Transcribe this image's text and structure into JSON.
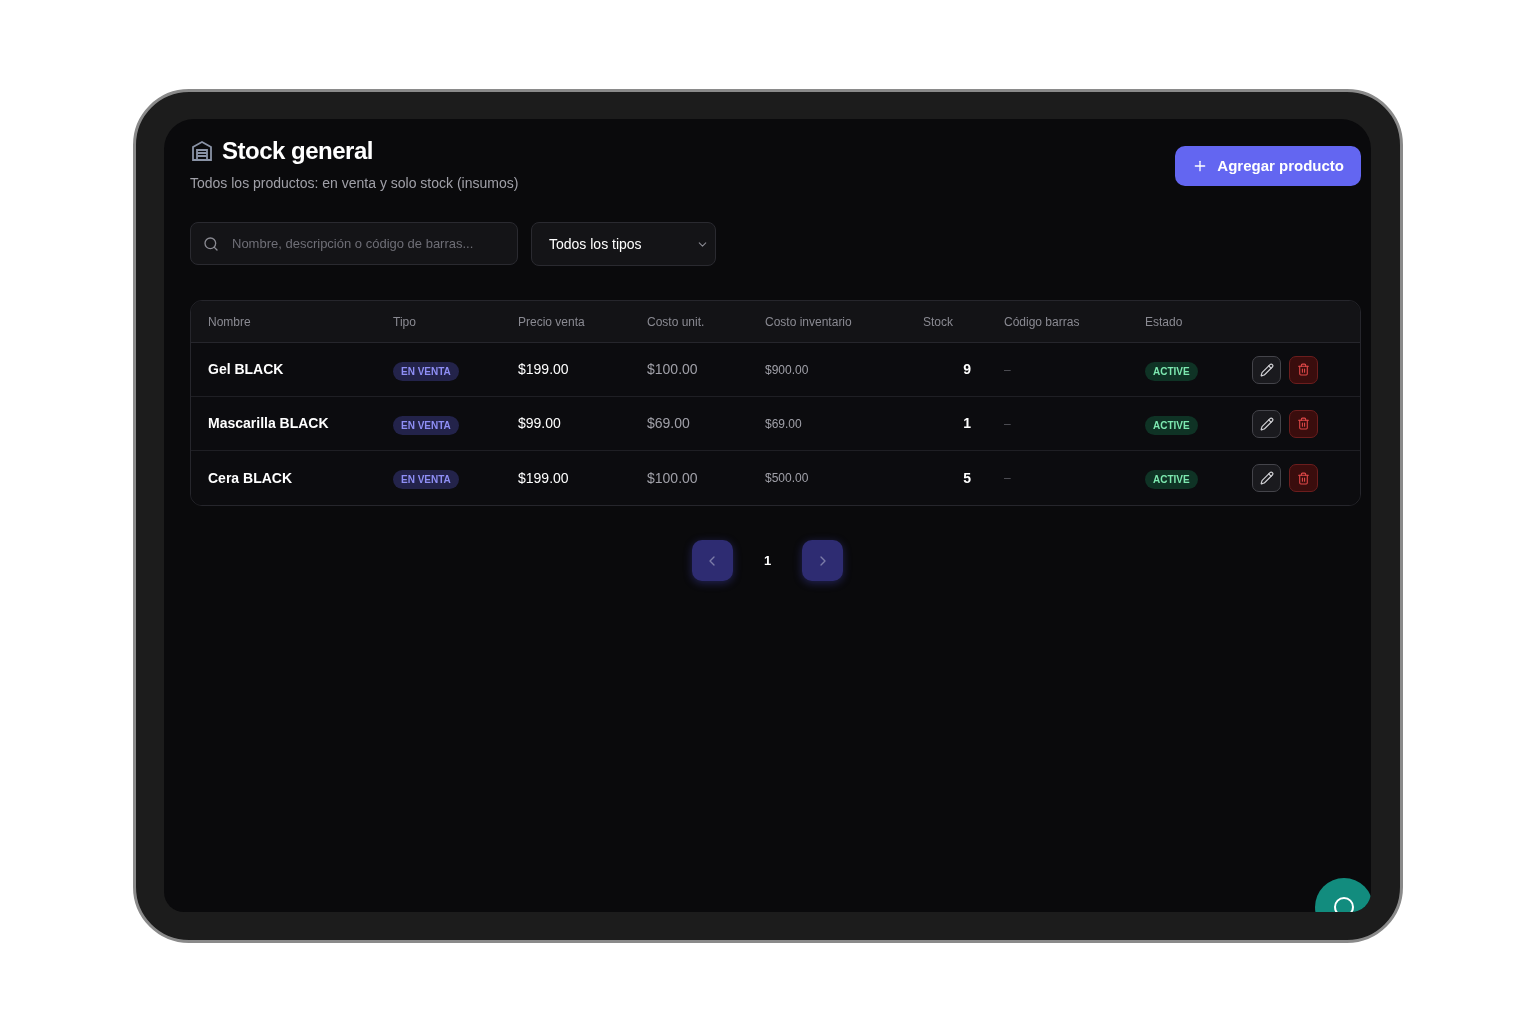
{
  "header": {
    "title": "Stock general",
    "subtitle": "Todos los productos: en venta y solo stock (insumos)",
    "add_button": "Agregar producto"
  },
  "filters": {
    "search": {
      "placeholder": "Nombre, descripción o código de barras..."
    },
    "type_select": {
      "value": "Todos los tipos"
    }
  },
  "table": {
    "columns": [
      "Nombre",
      "Tipo",
      "Precio venta",
      "Costo unit.",
      "Costo inventario",
      "Stock",
      "Código barras",
      "Estado"
    ],
    "rows": [
      {
        "name": "Gel BLACK",
        "type": "EN VENTA",
        "price": "$199.00",
        "unit_cost": "$100.00",
        "inventory_cost": "$900.00",
        "stock": "9",
        "barcode": "–",
        "status": "ACTIVE"
      },
      {
        "name": "Mascarilla BLACK",
        "type": "EN VENTA",
        "price": "$99.00",
        "unit_cost": "$69.00",
        "inventory_cost": "$69.00",
        "stock": "1",
        "barcode": "–",
        "status": "ACTIVE"
      },
      {
        "name": "Cera BLACK",
        "type": "EN VENTA",
        "price": "$199.00",
        "unit_cost": "$100.00",
        "inventory_cost": "$500.00",
        "stock": "5",
        "barcode": "–",
        "status": "ACTIVE"
      }
    ]
  },
  "pagination": {
    "current_page": "1"
  }
}
